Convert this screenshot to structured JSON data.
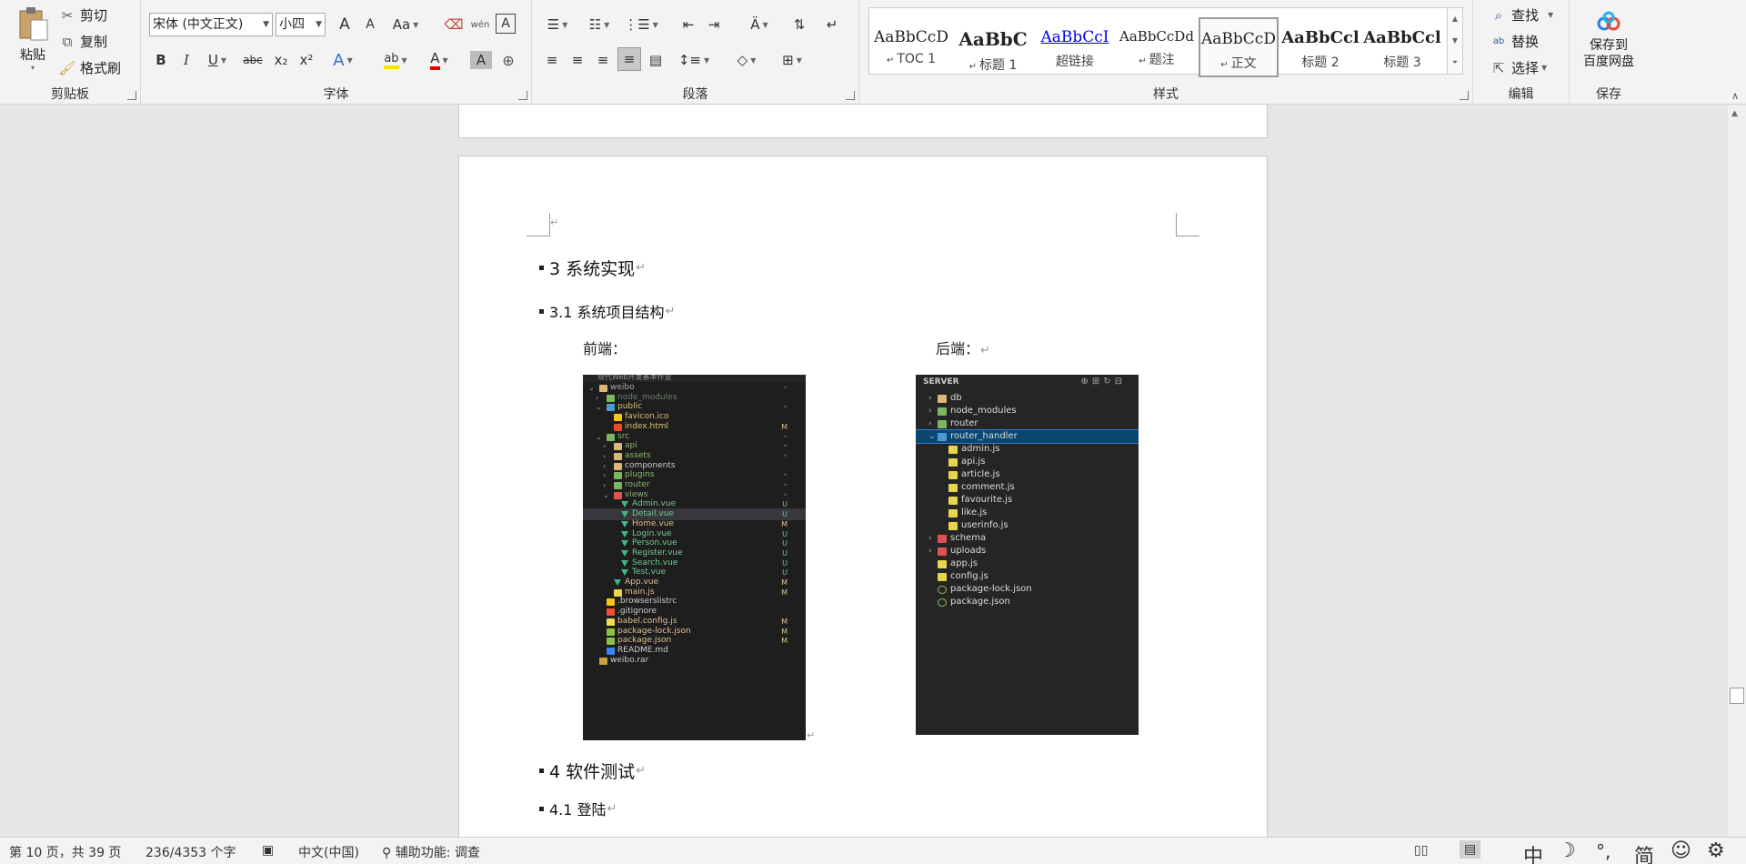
{
  "clipboard": {
    "paste": "粘贴",
    "cut": "剪切",
    "copy": "复制",
    "format_painter": "格式刷",
    "label": "剪贴板"
  },
  "font": {
    "name": "宋体 (中文正文)",
    "size": "小四",
    "label": "字体",
    "grow": "A",
    "shrink": "A",
    "case": "Aa",
    "bold": "B",
    "italic": "I",
    "underline": "U",
    "strike": "abc",
    "sub": "x₂",
    "sup": "x²",
    "text_effect": "A",
    "highlight": "ab",
    "font_color": "A",
    "shading": "A",
    "circle": "⊕",
    "phonetic": "wén",
    "border_char": "A"
  },
  "paragraph": {
    "label": "段落"
  },
  "styles": {
    "label": "样式",
    "items": [
      {
        "preview": "AaBbCcD",
        "name": "TOC 1",
        "mark": "↵"
      },
      {
        "preview": "AaBbC",
        "name": "标题 1",
        "mark": "↵"
      },
      {
        "preview": "AaBbCcI",
        "name": "超链接",
        "mark": ""
      },
      {
        "preview": "AaBbCcDd",
        "name": "题注",
        "mark": "↵"
      },
      {
        "preview": "AaBbCcD",
        "name": "正文",
        "mark": "↵"
      },
      {
        "preview": "AaBbCcl",
        "name": "标题 2",
        "mark": ""
      },
      {
        "preview": "AaBbCcl",
        "name": "标题 3",
        "mark": ""
      }
    ]
  },
  "editing": {
    "find": "查找",
    "replace": "替换",
    "select": "选择",
    "label": "编辑"
  },
  "save": {
    "button": "保存到\n百度网盘",
    "line1": "保存到",
    "line2": "百度网盘",
    "label": "保存"
  },
  "doc": {
    "h1": "3  系统实现",
    "h2": "3.1  系统项目结构",
    "frontend": "前端：",
    "backend": "后端：",
    "h3": "4  软件测试",
    "h4": "4.1  登陆",
    "mark": "↵"
  },
  "frontend_tree": {
    "header": "现代Web开发基本作业",
    "rows": [
      {
        "name": "weibo",
        "indent": 0,
        "type": "folder",
        "color": "#aaaaaa",
        "chevron": "v",
        "badge": "•",
        "bcolor": "#3a7d3a"
      },
      {
        "name": "node_modules",
        "indent": 1,
        "type": "folder-green",
        "color": "#6f7f6f",
        "chevron": ">",
        "badge": "",
        "bcolor": ""
      },
      {
        "name": "public",
        "indent": 1,
        "type": "folder-blue",
        "color": "#e0c06a",
        "chevron": "v",
        "badge": "•",
        "bcolor": "#3a7d3a"
      },
      {
        "name": "favicon.ico",
        "indent": 2,
        "type": "star",
        "color": "#e0c06a",
        "chevron": "",
        "badge": "",
        "bcolor": ""
      },
      {
        "name": "index.html",
        "indent": 2,
        "type": "html",
        "color": "#e0c06a",
        "chevron": "",
        "badge": "M",
        "bcolor": "#d7ba7d"
      },
      {
        "name": "src",
        "indent": 1,
        "type": "folder-green",
        "color": "#89b86a",
        "chevron": "v",
        "badge": "•",
        "bcolor": "#3a7d3a"
      },
      {
        "name": "api",
        "indent": 2,
        "type": "folder",
        "color": "#89b86a",
        "chevron": ">",
        "badge": "•",
        "bcolor": "#3a7d3a"
      },
      {
        "name": "assets",
        "indent": 2,
        "type": "folder",
        "color": "#89b86a",
        "chevron": ">",
        "badge": "•",
        "bcolor": "#3a7d3a"
      },
      {
        "name": "components",
        "indent": 2,
        "type": "folder",
        "color": "#cccccc",
        "chevron": ">",
        "badge": "",
        "bcolor": ""
      },
      {
        "name": "plugins",
        "indent": 2,
        "type": "folder-green",
        "color": "#89b86a",
        "chevron": ">",
        "badge": "•",
        "bcolor": "#3a7d3a"
      },
      {
        "name": "router",
        "indent": 2,
        "type": "folder-green",
        "color": "#89b86a",
        "chevron": ">",
        "badge": "•",
        "bcolor": "#3a7d3a"
      },
      {
        "name": "views",
        "indent": 2,
        "type": "folder-red",
        "color": "#89b86a",
        "chevron": "v",
        "badge": "•",
        "bcolor": "#3a7d3a"
      },
      {
        "name": "Admin.vue",
        "indent": 3,
        "type": "vue",
        "color": "#73c991",
        "chevron": "",
        "badge": "U",
        "bcolor": "#73c991"
      },
      {
        "name": "Detail.vue",
        "indent": 3,
        "type": "vue",
        "color": "#73c991",
        "chevron": "",
        "badge": "U",
        "bcolor": "#73c991",
        "sel": true
      },
      {
        "name": "Home.vue",
        "indent": 3,
        "type": "vue",
        "color": "#e2c08d",
        "chevron": "",
        "badge": "M",
        "bcolor": "#e2c08d"
      },
      {
        "name": "Login.vue",
        "indent": 3,
        "type": "vue",
        "color": "#73c991",
        "chevron": "",
        "badge": "U",
        "bcolor": "#73c991"
      },
      {
        "name": "Person.vue",
        "indent": 3,
        "type": "vue",
        "color": "#73c991",
        "chevron": "",
        "badge": "U",
        "bcolor": "#73c991"
      },
      {
        "name": "Register.vue",
        "indent": 3,
        "type": "vue",
        "color": "#73c991",
        "chevron": "",
        "badge": "U",
        "bcolor": "#73c991"
      },
      {
        "name": "Search.vue",
        "indent": 3,
        "type": "vue",
        "color": "#73c991",
        "chevron": "",
        "badge": "U",
        "bcolor": "#73c991"
      },
      {
        "name": "Test.vue",
        "indent": 3,
        "type": "vue",
        "color": "#73c991",
        "chevron": "",
        "badge": "U",
        "bcolor": "#73c991"
      },
      {
        "name": "App.vue",
        "indent": 2,
        "type": "vue",
        "color": "#e2c08d",
        "chevron": "",
        "badge": "M",
        "bcolor": "#e2c08d"
      },
      {
        "name": "main.js",
        "indent": 2,
        "type": "js",
        "color": "#e2c08d",
        "chevron": "",
        "badge": "M",
        "bcolor": "#e2c08d"
      },
      {
        "name": ".browserslistrc",
        "indent": 1,
        "type": "cfg",
        "color": "#cccccc",
        "chevron": "",
        "badge": "",
        "bcolor": ""
      },
      {
        "name": ".gitignore",
        "indent": 1,
        "type": "git",
        "color": "#cccccc",
        "chevron": "",
        "badge": "",
        "bcolor": ""
      },
      {
        "name": "babel.config.js",
        "indent": 1,
        "type": "babel",
        "color": "#e2c08d",
        "chevron": "",
        "badge": "M",
        "bcolor": "#e2c08d"
      },
      {
        "name": "package-lock.json",
        "indent": 1,
        "type": "json",
        "color": "#e2c08d",
        "chevron": "",
        "badge": "M",
        "bcolor": "#e2c08d"
      },
      {
        "name": "package.json",
        "indent": 1,
        "type": "json",
        "color": "#e2c08d",
        "chevron": "",
        "badge": "M",
        "bcolor": "#e2c08d"
      },
      {
        "name": "README.md",
        "indent": 1,
        "type": "info",
        "color": "#cccccc",
        "chevron": "",
        "badge": "",
        "bcolor": ""
      },
      {
        "name": "weibo.rar",
        "indent": 0,
        "type": "rar",
        "color": "#cccccc",
        "chevron": "",
        "badge": "",
        "bcolor": ""
      }
    ]
  },
  "backend_tree": {
    "header": "SERVER",
    "rows": [
      {
        "name": "db",
        "indent": 1,
        "type": "folder",
        "chevron": ">"
      },
      {
        "name": "node_modules",
        "indent": 1,
        "type": "folder-green",
        "chevron": ">"
      },
      {
        "name": "router",
        "indent": 1,
        "type": "folder-green",
        "chevron": ">"
      },
      {
        "name": "router_handler",
        "indent": 1,
        "type": "folder-blue",
        "chevron": "v",
        "sel": true
      },
      {
        "name": "admin.js",
        "indent": 2,
        "type": "js",
        "chevron": ""
      },
      {
        "name": "api.js",
        "indent": 2,
        "type": "js",
        "chevron": ""
      },
      {
        "name": "article.js",
        "indent": 2,
        "type": "js",
        "chevron": ""
      },
      {
        "name": "comment.js",
        "indent": 2,
        "type": "js",
        "chevron": ""
      },
      {
        "name": "favourite.js",
        "indent": 2,
        "type": "js",
        "chevron": ""
      },
      {
        "name": "like.js",
        "indent": 2,
        "type": "js",
        "chevron": ""
      },
      {
        "name": "userinfo.js",
        "indent": 2,
        "type": "js",
        "chevron": ""
      },
      {
        "name": "schema",
        "indent": 1,
        "type": "folder-red",
        "chevron": ">"
      },
      {
        "name": "uploads",
        "indent": 1,
        "type": "folder-red",
        "chevron": ">"
      },
      {
        "name": "app.js",
        "indent": 1,
        "type": "js",
        "chevron": ""
      },
      {
        "name": "config.js",
        "indent": 1,
        "type": "js",
        "chevron": ""
      },
      {
        "name": "package-lock.json",
        "indent": 1,
        "type": "json",
        "chevron": ""
      },
      {
        "name": "package.json",
        "indent": 1,
        "type": "json",
        "chevron": ""
      }
    ]
  },
  "status": {
    "page": "第 10 页，共 39 页",
    "words": "236/4353 个字",
    "lang": "中文(中国)",
    "accessibility": "辅助功能: 调查",
    "ime_zh": "中",
    "ime_moon": "☽",
    "ime_punct": "°,",
    "ime_simp": "简",
    "ime_emoji": "☺",
    "ime_gear": "⚙"
  },
  "colors": {
    "accent": "#2b579a",
    "selection": "#094771",
    "vscode_bg": "#1e1e1e"
  },
  "icons": [
    "paste-icon",
    "scissors-icon",
    "copy-icon",
    "format-painter-icon",
    "search-icon",
    "replace-icon",
    "select-icon",
    "baidu-cloud-icon"
  ]
}
